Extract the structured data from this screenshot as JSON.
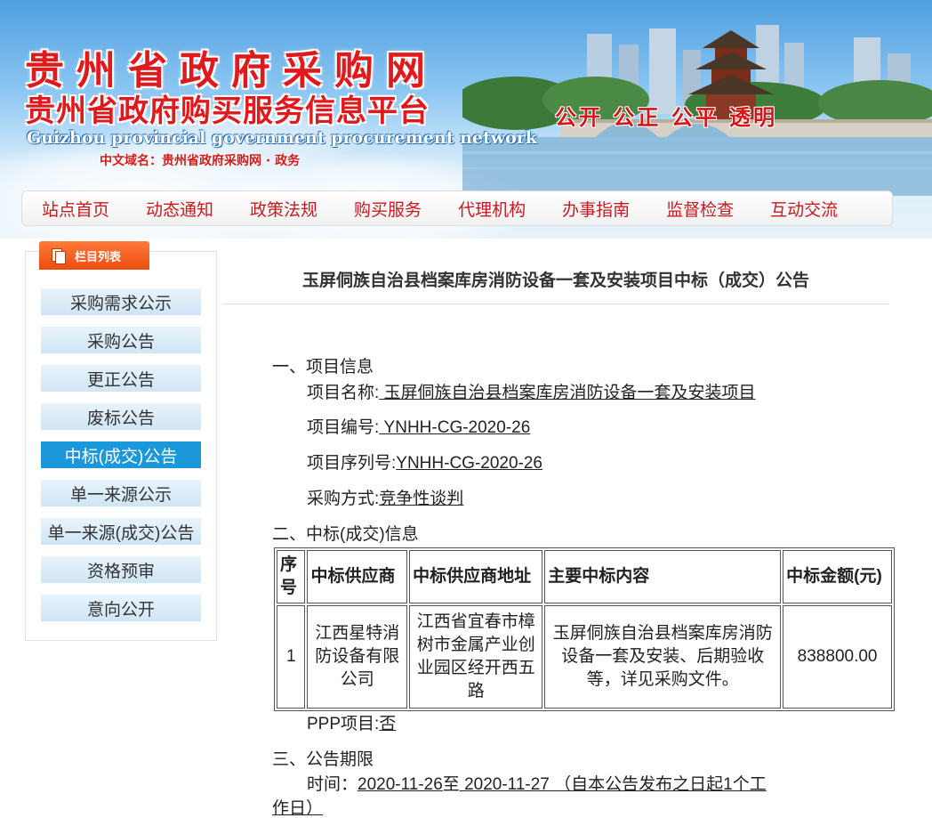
{
  "header": {
    "title_main": "贵州省政府采购网",
    "title_sub": "贵州省政府购买服务信息平台",
    "title_en": "Guizhou provincial government procurement network",
    "domain_text": "中文域名：贵州省政府采购网 · 政务",
    "slogan": "公开 公正 公平 透明"
  },
  "nav": {
    "items": [
      "站点首页",
      "动态通知",
      "政策法规",
      "购买服务",
      "代理机构",
      "办事指南",
      "监督检查",
      "互动交流"
    ]
  },
  "sidebar": {
    "tab_label": "栏目列表",
    "items": [
      "采购需求公示",
      "采购公告",
      "更正公告",
      "废标公告",
      "中标(成交)公告",
      "单一来源公示",
      "单一来源(成交)公告",
      "资格预审",
      "意向公开"
    ],
    "active_index": 4
  },
  "article": {
    "title": "玉屏侗族自治县档案库房消防设备一套及安装项目中标（成交）公告",
    "section1_heading": "一、项目信息",
    "project_name_label": "项目名称:",
    "project_name_value": " 玉屏侗族自治县档案库房消防设备一套及安装项目",
    "project_no_label": "项目编号:",
    "project_no_value": " YNHH-CG-2020-26",
    "project_seq_label": "项目序列号:",
    "project_seq_value": "YNHH-CG-2020-26",
    "method_label": "采购方式:",
    "method_value": "竞争性谈判",
    "section2_heading": "二、中标(成交)信息",
    "table": {
      "headers": [
        "序号",
        "中标供应商",
        "中标供应商地址",
        "主要中标内容",
        "中标金额(元)"
      ],
      "rows": [
        [
          "1",
          "江西星特消防设备有限公司",
          "江西省宜春市樟树市金属产业创业园区经开西五路",
          "玉屏侗族自治县档案库房消防设备一套及安装、后期验收等，详见采购文件。",
          "838800.00"
        ]
      ]
    },
    "ppp_label": "PPP项目:",
    "ppp_value": "否",
    "section3_heading": "三、公告期限",
    "period_label": "时间：",
    "period_start": "2020-11-26",
    "period_sep": "至",
    "period_end": " 2020-11-27 （自本公告发布之日起1个工",
    "period_end_wrap": "作日）"
  },
  "colors": {
    "brand_red": "#e0191d",
    "nav_text": "#c8191e",
    "sidebar_active": "#1b98d9",
    "tab_orange": "#ea4d10"
  }
}
